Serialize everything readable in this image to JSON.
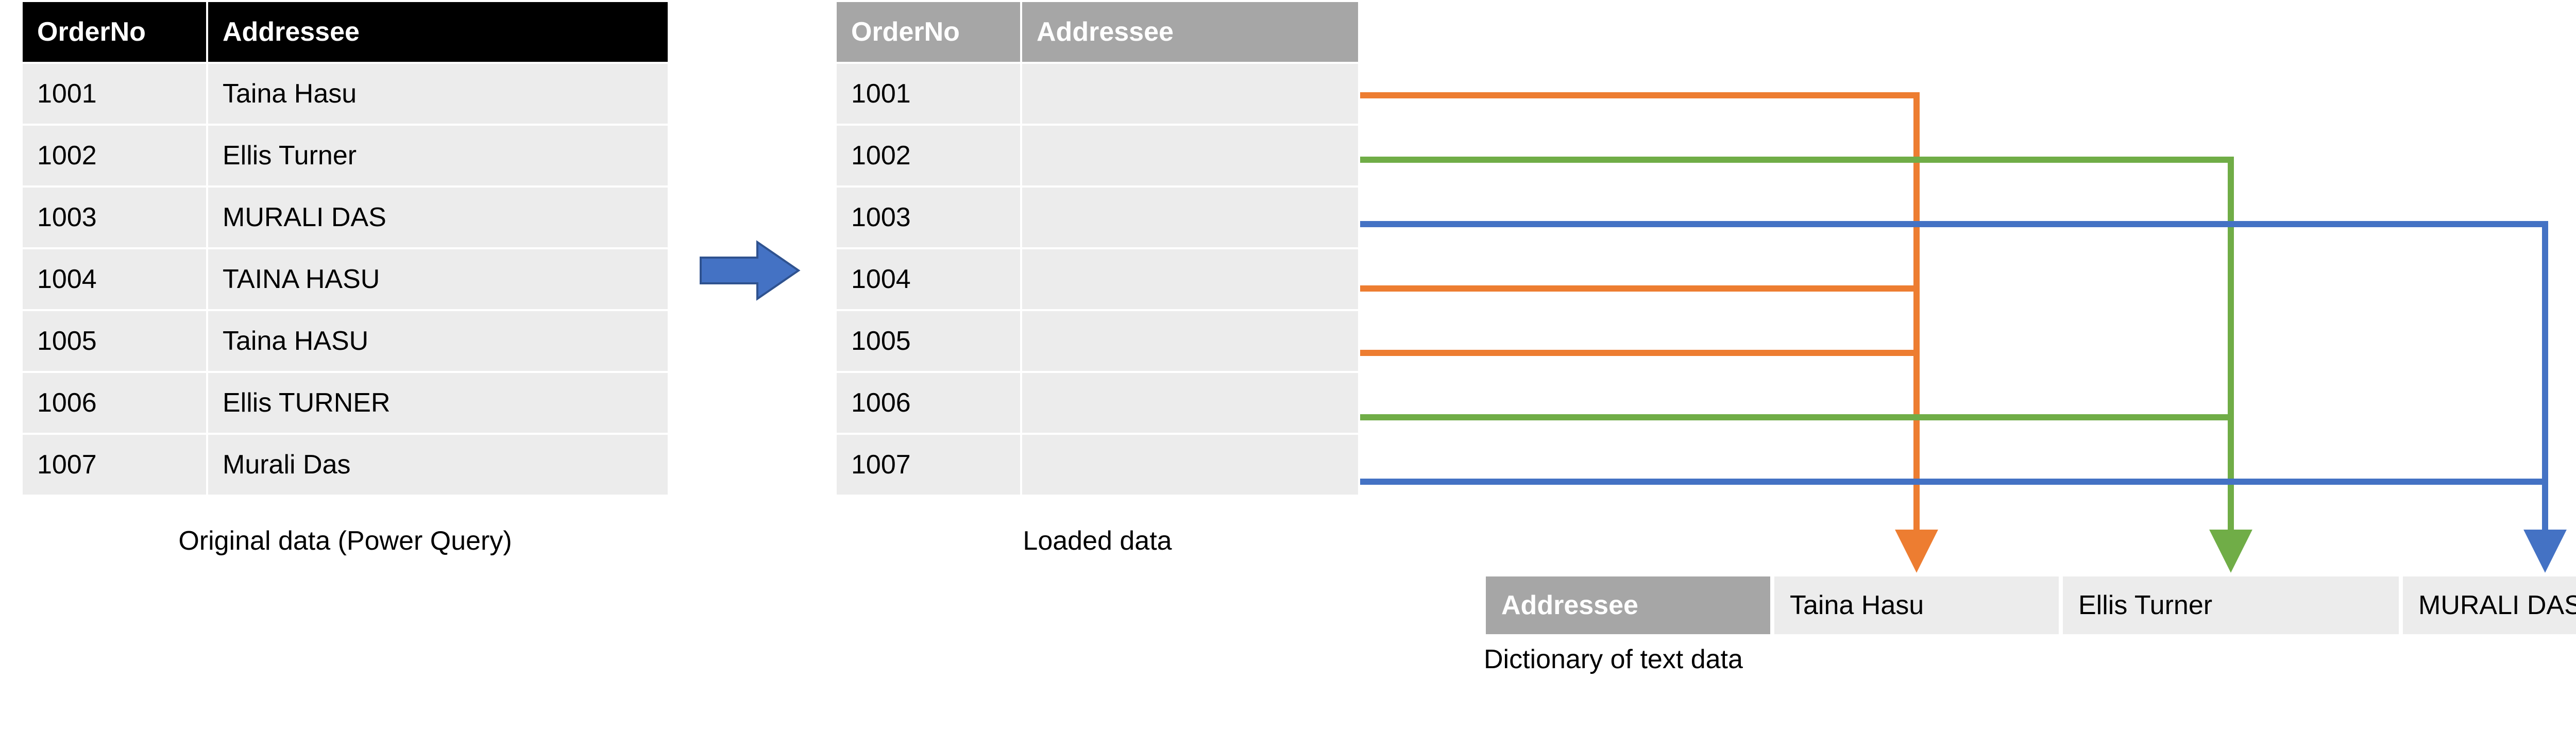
{
  "original_table": {
    "headers": [
      "OrderNo",
      "Addressee"
    ],
    "rows": [
      {
        "order": "1001",
        "addr": "Taina Hasu"
      },
      {
        "order": "1002",
        "addr": "Ellis Turner"
      },
      {
        "order": "1003",
        "addr": "MURALI DAS"
      },
      {
        "order": "1004",
        "addr": "TAINA HASU"
      },
      {
        "order": "1005",
        "addr": "Taina HASU"
      },
      {
        "order": "1006",
        "addr": "Ellis TURNER"
      },
      {
        "order": "1007",
        "addr": "Murali Das"
      }
    ],
    "caption": "Original data (Power Query)"
  },
  "loaded_table": {
    "headers": [
      "OrderNo",
      "Addressee"
    ],
    "rows": [
      {
        "order": "1001",
        "addr": ""
      },
      {
        "order": "1002",
        "addr": ""
      },
      {
        "order": "1003",
        "addr": ""
      },
      {
        "order": "1004",
        "addr": ""
      },
      {
        "order": "1005",
        "addr": ""
      },
      {
        "order": "1006",
        "addr": ""
      },
      {
        "order": "1007",
        "addr": ""
      }
    ],
    "caption": "Loaded data"
  },
  "dictionary": {
    "header": "Addressee",
    "values": [
      "Taina Hasu",
      "Ellis Turner",
      "MURALI DAS"
    ],
    "caption": "Dictionary of text data"
  },
  "colors": {
    "orange": "#ed7d31",
    "green": "#70ad47",
    "blue": "#4472c4"
  }
}
